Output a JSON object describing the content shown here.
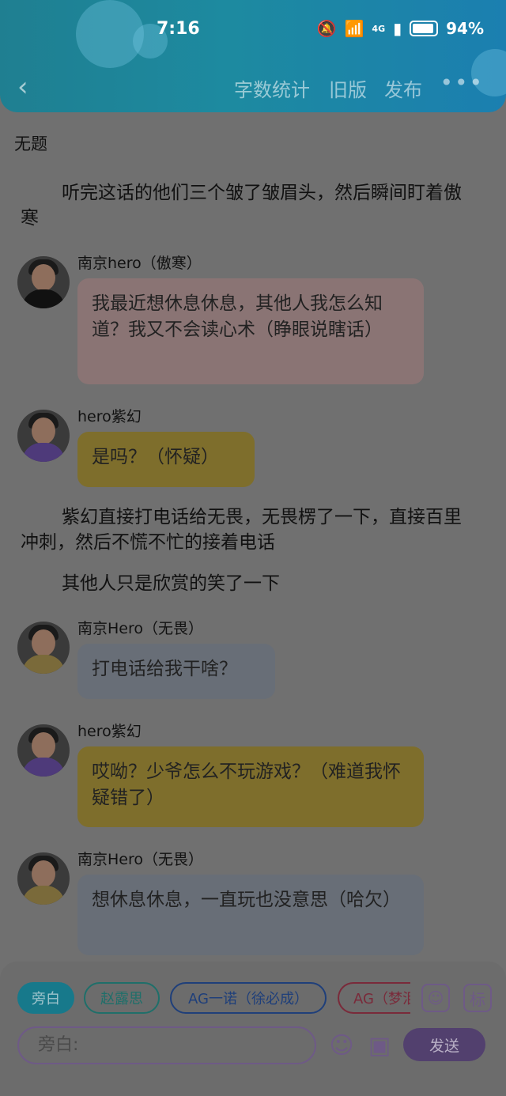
{
  "status": {
    "time": "7:16",
    "network": "4G",
    "battery": "94%"
  },
  "toolbar": {
    "word_count": "字数统计",
    "old_version": "旧版",
    "publish": "发布",
    "more": "•••"
  },
  "doc": {
    "title": "无题"
  },
  "story": [
    {
      "kind": "narration",
      "text": "听完这话的他们三个皱了皱眉头，然后瞬间盯着傲寒"
    },
    {
      "kind": "message",
      "speaker": "南京hero（傲寒）",
      "text": "我最近想休息休息，其他人我怎么知道？我又不会读心术（睁眼说瞎话）",
      "color": "#8a7474"
    },
    {
      "kind": "message",
      "speaker": "hero紫幻",
      "text": "是吗？（怀疑）",
      "color": "#7e6e2c"
    },
    {
      "kind": "narration",
      "text": "紫幻直接打电话给无畏，无畏楞了一下，直接百里冲刺，然后不慌不忙的接着电话"
    },
    {
      "kind": "narration",
      "text": "其他人只是欣赏的笑了一下"
    },
    {
      "kind": "message",
      "speaker": "南京Hero（无畏）",
      "text": "打电话给我干啥？",
      "color": "#686e77"
    },
    {
      "kind": "message",
      "speaker": "hero紫幻",
      "text": "哎呦？少爷怎么不玩游戏？（难道我怀疑错了）",
      "color": "#7e6e2c"
    },
    {
      "kind": "message",
      "speaker": "南京Hero（无畏）",
      "text": "想休息休息，一直玩也没意思（哈欠）",
      "color": "#686e77"
    }
  ],
  "roles": {
    "selected": "旁白",
    "items": [
      "旁白",
      "赵露思",
      "AG一诺（徐必成）",
      "AG（梦泪）"
    ]
  },
  "role_icons": {
    "person": "person-icon",
    "tag": "标"
  },
  "composer": {
    "placeholder": "旁白:",
    "emoji_icon": "emoji-icon",
    "image_icon": "image-icon",
    "send_label": "发送"
  },
  "colors": {
    "accent": "#1d8aa0",
    "purple": "#6e5a86",
    "send": "#52406e"
  }
}
